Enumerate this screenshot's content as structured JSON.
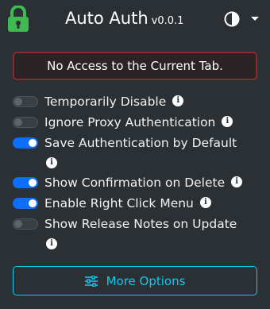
{
  "header": {
    "title": "Auto Auth",
    "version": "v0.0.1",
    "logo_icon": "padlock-icon",
    "theme_icon": "contrast-icon",
    "accent": "#3fb950"
  },
  "alert": {
    "message": "No Access to the Current Tab.",
    "border_color": "#8b2a2e"
  },
  "options": [
    {
      "label": "Temporarily Disable",
      "enabled": false
    },
    {
      "label": "Ignore Proxy Authentication",
      "enabled": false
    },
    {
      "label": "Save Authentication by Default",
      "enabled": true
    },
    {
      "label": "Show Confirmation on Delete",
      "enabled": true
    },
    {
      "label": "Enable Right Click Menu",
      "enabled": true
    },
    {
      "label": "Show Release Notes on Update",
      "enabled": false
    }
  ],
  "info_glyph": "i",
  "more_options": {
    "label": "More Options",
    "icon": "sliders-icon",
    "color": "#0dcaf0"
  }
}
